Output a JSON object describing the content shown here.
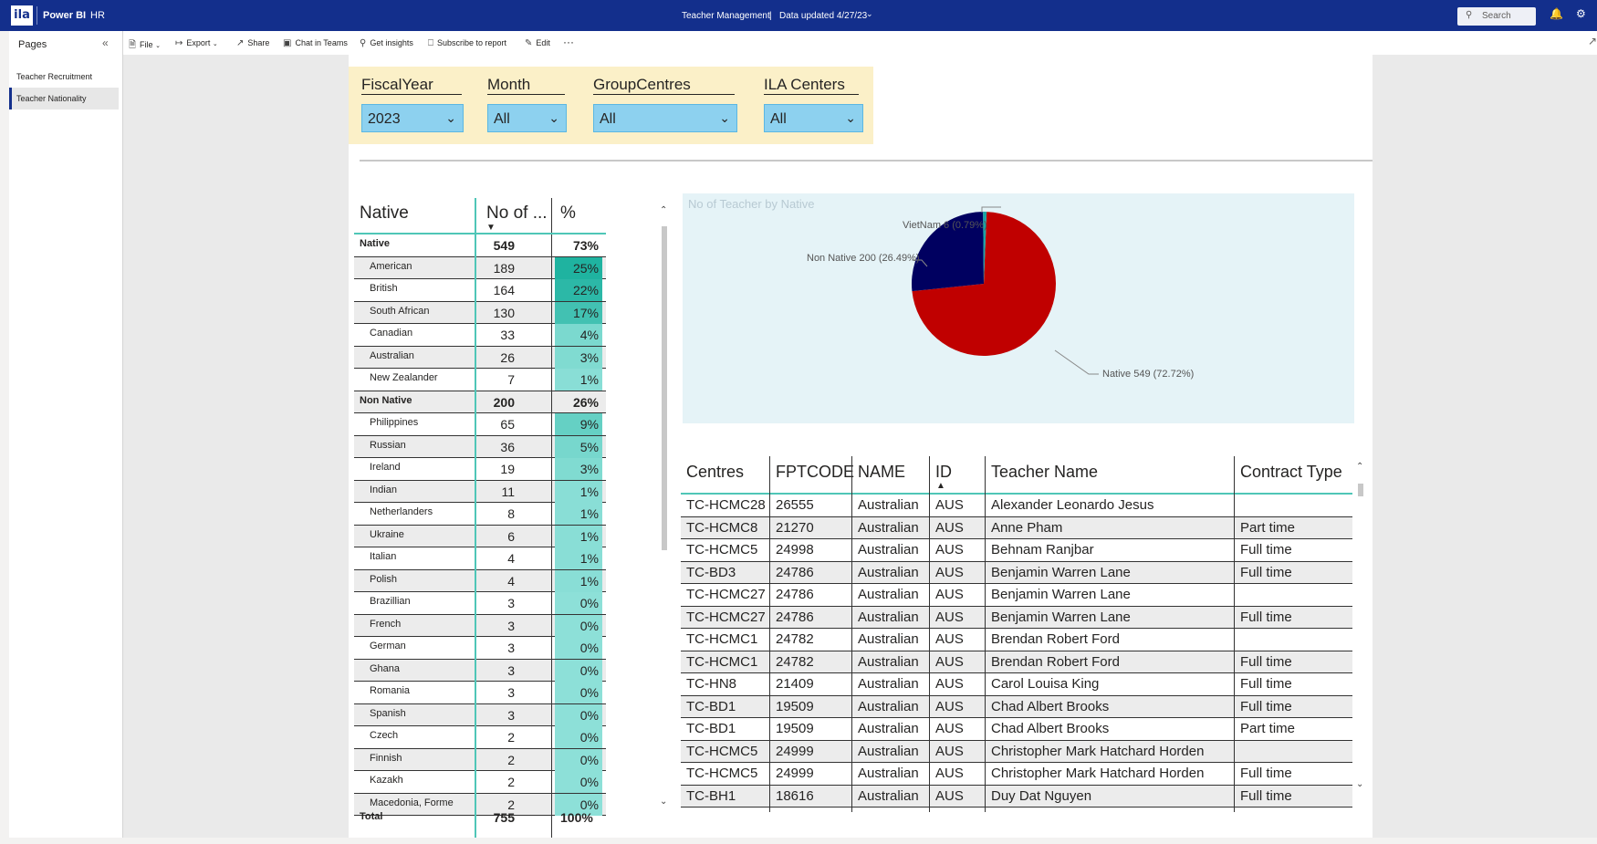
{
  "topbar": {
    "logo_text": "ila",
    "app_name": "Power BI",
    "workspace": "HR",
    "report_title": "Teacher Management",
    "separator": "|",
    "data_updated": "Data updated 4/27/23",
    "search_placeholder": "Search"
  },
  "nav": {
    "title": "Pages",
    "pages": [
      {
        "label": "Teacher Recruitment",
        "active": false
      },
      {
        "label": "Teacher Nationality",
        "active": true
      }
    ]
  },
  "toolbar": {
    "file": "File",
    "export": "Export",
    "share": "Share",
    "chat": "Chat in Teams",
    "insights": "Get insights",
    "subscribe": "Subscribe to report",
    "edit": "Edit",
    "more": "···"
  },
  "slicers": [
    {
      "label": "FiscalYear",
      "value": "2023"
    },
    {
      "label": "Month",
      "value": "All"
    },
    {
      "label": "GroupCentres",
      "value": "All"
    },
    {
      "label": "ILA Centers",
      "value": "All"
    }
  ],
  "matrix": {
    "headers": {
      "col1": "Native",
      "col2": "No of ...",
      "col3": "%"
    },
    "rows": [
      {
        "name": "Native",
        "count": "549",
        "pct": "73%",
        "pct_value": 73,
        "group": true
      },
      {
        "name": "American",
        "count": "189",
        "pct": "25%",
        "pct_value": 25
      },
      {
        "name": "British",
        "count": "164",
        "pct": "22%",
        "pct_value": 22
      },
      {
        "name": "South African",
        "count": "130",
        "pct": "17%",
        "pct_value": 17
      },
      {
        "name": "Canadian",
        "count": "33",
        "pct": "4%",
        "pct_value": 4
      },
      {
        "name": "Australian",
        "count": "26",
        "pct": "3%",
        "pct_value": 3
      },
      {
        "name": "New Zealander",
        "count": "7",
        "pct": "1%",
        "pct_value": 1
      },
      {
        "name": "Non Native",
        "count": "200",
        "pct": "26%",
        "pct_value": 26,
        "group": true
      },
      {
        "name": "Philippines",
        "count": "65",
        "pct": "9%",
        "pct_value": 9
      },
      {
        "name": "Russian",
        "count": "36",
        "pct": "5%",
        "pct_value": 5
      },
      {
        "name": "Ireland",
        "count": "19",
        "pct": "3%",
        "pct_value": 3
      },
      {
        "name": "Indian",
        "count": "11",
        "pct": "1%",
        "pct_value": 1
      },
      {
        "name": "Netherlanders",
        "count": "8",
        "pct": "1%",
        "pct_value": 1
      },
      {
        "name": "Ukraine",
        "count": "6",
        "pct": "1%",
        "pct_value": 1
      },
      {
        "name": "Italian",
        "count": "4",
        "pct": "1%",
        "pct_value": 1
      },
      {
        "name": "Polish",
        "count": "4",
        "pct": "1%",
        "pct_value": 1
      },
      {
        "name": "Brazillian",
        "count": "3",
        "pct": "0%",
        "pct_value": 0
      },
      {
        "name": "French",
        "count": "3",
        "pct": "0%",
        "pct_value": 0
      },
      {
        "name": "German",
        "count": "3",
        "pct": "0%",
        "pct_value": 0
      },
      {
        "name": "Ghana",
        "count": "3",
        "pct": "0%",
        "pct_value": 0
      },
      {
        "name": "Romania",
        "count": "3",
        "pct": "0%",
        "pct_value": 0
      },
      {
        "name": "Spanish",
        "count": "3",
        "pct": "0%",
        "pct_value": 0
      },
      {
        "name": "Czech",
        "count": "2",
        "pct": "0%",
        "pct_value": 0
      },
      {
        "name": "Finnish",
        "count": "2",
        "pct": "0%",
        "pct_value": 0
      },
      {
        "name": "Kazakh",
        "count": "2",
        "pct": "0%",
        "pct_value": 0
      },
      {
        "name": "Macedonia, Forme",
        "count": "2",
        "pct": "0%",
        "pct_value": 0
      }
    ],
    "total": {
      "label": "Total",
      "count": "755",
      "pct": "100%"
    }
  },
  "colors": {
    "header_blue": "#132f8c",
    "slicer_bg": "#fbf0c8",
    "slicer_box": "#8dd1ef",
    "teal_line": "#4fc6b7",
    "pct_high": "#1fb3a0",
    "pct_low": "#8de0d8",
    "pie_bg": "#e5f3f7",
    "native": "#c00000",
    "non_native": "#000060",
    "vietnam": "#1aa3a3"
  },
  "chart_data": {
    "type": "pie",
    "title": "No of Teacher by Native",
    "slices": [
      {
        "label": "Native",
        "value": 549,
        "percent": 72.72,
        "color": "#c00000",
        "text": "Native 549 (72.72%)"
      },
      {
        "label": "Non Native",
        "value": 200,
        "percent": 26.49,
        "color": "#000060",
        "text": "Non Native 200 (26.49%)"
      },
      {
        "label": "VietNam",
        "value": 6,
        "percent": 0.79,
        "color": "#1aa3a3",
        "text": "VietNam 6 (0.79%)"
      }
    ]
  },
  "detail": {
    "headers": [
      "Centres",
      "FPTCODE",
      "NAME",
      "ID",
      "Teacher Name",
      "Contract Type"
    ],
    "rows": [
      [
        "TC-HCMC28",
        "26555",
        "Australian",
        "AUS",
        "Alexander Leonardo Jesus",
        ""
      ],
      [
        "TC-HCMC8",
        "21270",
        "Australian",
        "AUS",
        "Anne Pham",
        "Part time"
      ],
      [
        "TC-HCMC5",
        "24998",
        "Australian",
        "AUS",
        "Behnam Ranjbar",
        "Full time"
      ],
      [
        "TC-BD3",
        "24786",
        "Australian",
        "AUS",
        "Benjamin Warren Lane",
        "Full time"
      ],
      [
        "TC-HCMC27",
        "24786",
        "Australian",
        "AUS",
        "Benjamin Warren Lane",
        ""
      ],
      [
        "TC-HCMC27",
        "24786",
        "Australian",
        "AUS",
        "Benjamin Warren Lane",
        "Full time"
      ],
      [
        "TC-HCMC1",
        "24782",
        "Australian",
        "AUS",
        "Brendan Robert Ford",
        ""
      ],
      [
        "TC-HCMC1",
        "24782",
        "Australian",
        "AUS",
        "Brendan Robert Ford",
        "Full time"
      ],
      [
        "TC-HN8",
        "21409",
        "Australian",
        "AUS",
        "Carol Louisa King",
        "Full time"
      ],
      [
        "TC-BD1",
        "19509",
        "Australian",
        "AUS",
        "Chad Albert Brooks",
        "Full time"
      ],
      [
        "TC-BD1",
        "19509",
        "Australian",
        "AUS",
        "Chad Albert Brooks",
        "Part time"
      ],
      [
        "TC-HCMC5",
        "24999",
        "Australian",
        "AUS",
        "Christopher Mark Hatchard Horden",
        ""
      ],
      [
        "TC-HCMC5",
        "24999",
        "Australian",
        "AUS",
        "Christopher Mark Hatchard Horden",
        "Full time"
      ],
      [
        "TC-BH1",
        "18616",
        "Australian",
        "AUS",
        "Duy Dat Nguyen",
        "Full time"
      ]
    ]
  }
}
